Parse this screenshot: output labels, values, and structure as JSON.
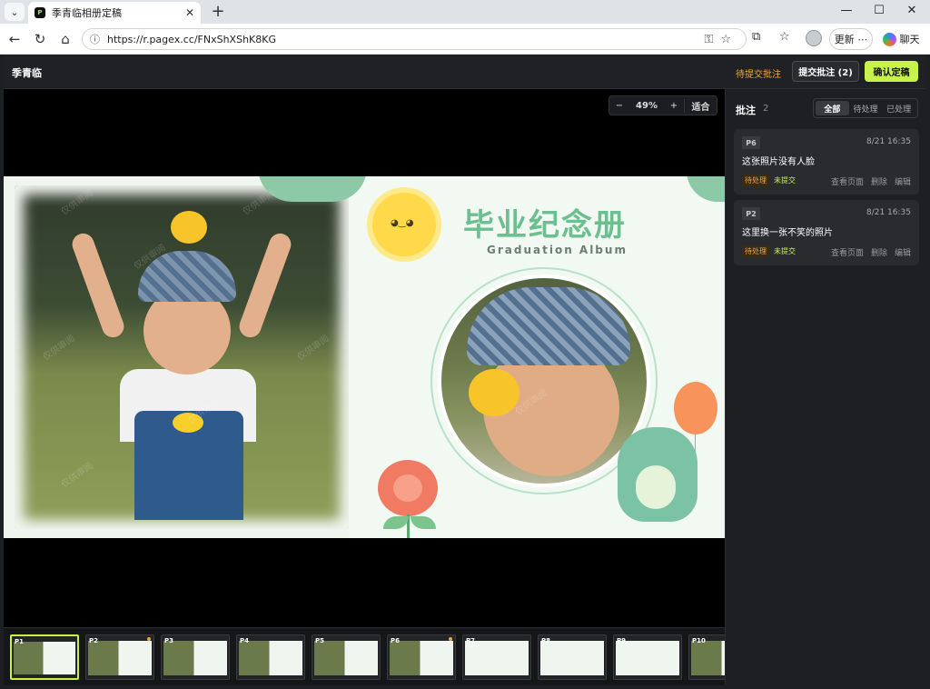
{
  "browser": {
    "tab_title": "季青临相册定稿",
    "url": "https://r.pagex.cc/FNxShXShK8KG",
    "update_label": "更新",
    "chat_label": "聊天"
  },
  "app": {
    "title": "季青临",
    "pending_link": "待提交批注",
    "submit_label": "提交批注 (2)",
    "confirm_label": "确认定稿"
  },
  "viewer": {
    "zoom_minus": "−",
    "zoom_value": "49%",
    "zoom_plus": "+",
    "zoom_fit": "适合"
  },
  "spread": {
    "album_title": "毕业纪念册",
    "album_subtitle": "Graduation Album",
    "watermark": "仅供审阅"
  },
  "comments": {
    "title": "批注",
    "count": "2",
    "filters": [
      "全部",
      "待处理",
      "已处理"
    ],
    "items": [
      {
        "page": "P6",
        "time": "8/21 16:35",
        "text": "这张照片没有人脸",
        "status": "待处理",
        "submit": "未提交",
        "actions": [
          "查看页面",
          "删除",
          "编辑"
        ]
      },
      {
        "page": "P2",
        "time": "8/21 16:35",
        "text": "这里换一张不笑的照片",
        "status": "待处理",
        "submit": "未提交",
        "actions": [
          "查看页面",
          "删除",
          "编辑"
        ]
      }
    ]
  },
  "filmstrip": {
    "pages": [
      "P1",
      "P2",
      "P3",
      "P4",
      "P5",
      "P6",
      "P7",
      "P8",
      "P9",
      "P10"
    ],
    "active": "P1"
  },
  "colors": {
    "accent": "#c6f24a",
    "warning": "#f3a73b"
  }
}
